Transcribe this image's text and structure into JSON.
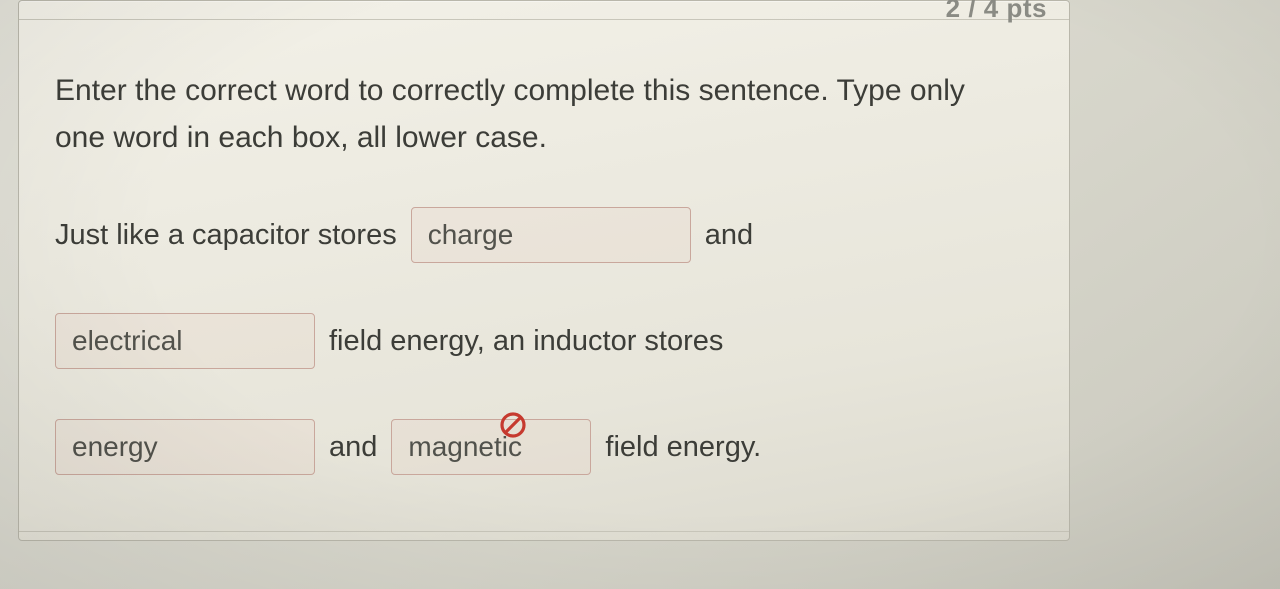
{
  "header": {
    "points_label": "2 / 4 pts"
  },
  "instructions": "Enter the correct word to correctly complete this sentence.  Type only one word in each box, all lower case.",
  "sentence": {
    "frag1": "Just like a capacitor stores",
    "blank1": "charge",
    "frag2": "and",
    "blank2": "electrical",
    "frag3": "field energy, an inductor stores",
    "blank3": "energy",
    "frag4": "and",
    "blank4": "magnetic",
    "frag5": "field energy."
  }
}
